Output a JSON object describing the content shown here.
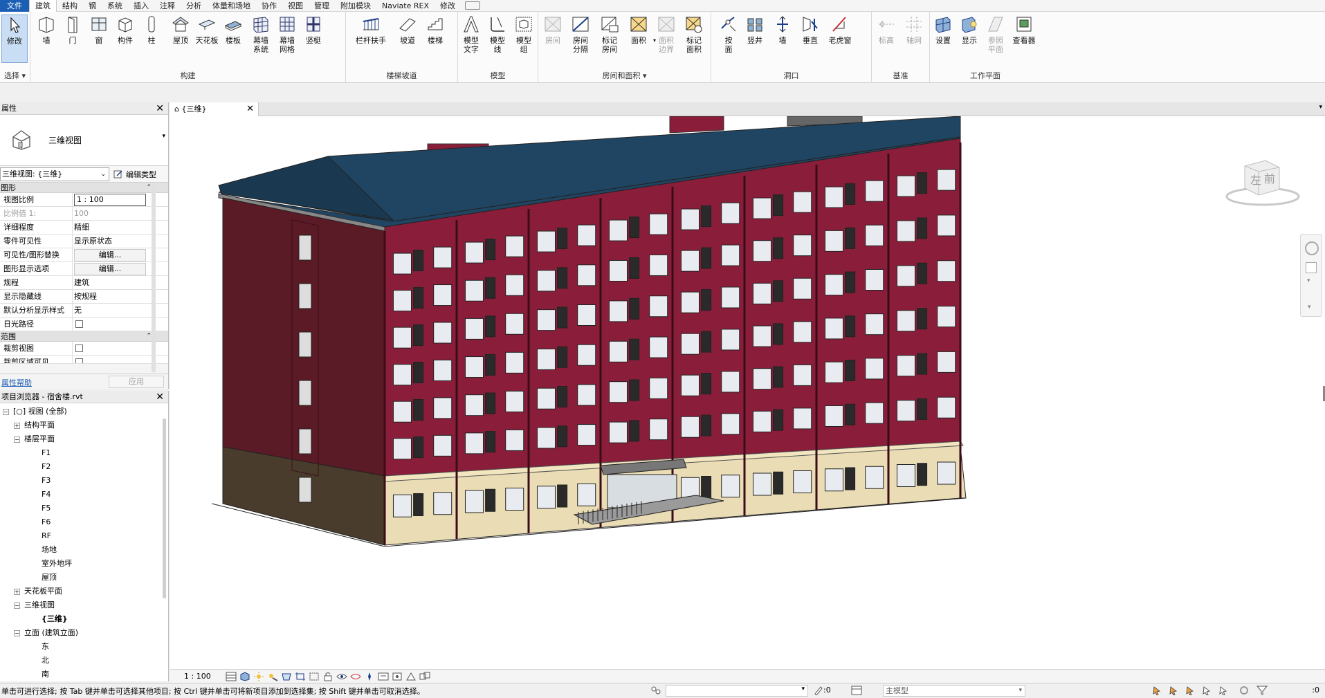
{
  "menu": {
    "items": [
      "文件",
      "建筑",
      "结构",
      "钢",
      "系统",
      "插入",
      "注释",
      "分析",
      "体量和场地",
      "协作",
      "视图",
      "管理",
      "附加模块",
      "Naviate REX",
      "修改"
    ]
  },
  "ribbon": {
    "select": {
      "tool": "修改",
      "label": "选择"
    },
    "build": {
      "label": "构建",
      "tools": [
        "墙",
        "门",
        "窗",
        "构件",
        "柱",
        "屋顶",
        "天花板",
        "楼板",
        "幕墙\n系统",
        "幕墙\n网格",
        "竖梃"
      ]
    },
    "circulation": {
      "label": "楼梯坡道",
      "tools": [
        "栏杆扶手",
        "坡道",
        "楼梯"
      ]
    },
    "model": {
      "label": "模型",
      "tools": [
        "模型\n文字",
        "模型\n线",
        "模型\n组"
      ]
    },
    "room_area": {
      "label": "房间和面积",
      "tools": [
        "房间",
        "房间\n分隔",
        "标记\n房间",
        "面积",
        "面积\n边界",
        "标记\n面积"
      ]
    },
    "opening": {
      "label": "洞口",
      "tools": [
        "按\n面",
        "竖井",
        "墙",
        "垂直",
        "老虎窗"
      ]
    },
    "datum": {
      "label": "基准",
      "tools": [
        "标高",
        "轴网"
      ]
    },
    "workplane": {
      "label": "工作平面",
      "tools": [
        "设置",
        "显示",
        "参照\n平面",
        "查看器"
      ]
    }
  },
  "properties": {
    "title": "属性",
    "type_name": "三维视图",
    "view_selector": "三维视图: {三维}",
    "edit_type": "编辑类型",
    "graphics_header": "图形",
    "rows": [
      {
        "name": "视图比例",
        "value": "1 : 100"
      },
      {
        "name": "比例值 1:",
        "value": "100"
      },
      {
        "name": "详细程度",
        "value": "精细"
      },
      {
        "name": "零件可见性",
        "value": "显示原状态"
      },
      {
        "name": "可见性/图形替换",
        "value": "编辑..."
      },
      {
        "name": "图形显示选项",
        "value": "编辑..."
      },
      {
        "name": "规程",
        "value": "建筑"
      },
      {
        "name": "显示隐藏线",
        "value": "按规程"
      },
      {
        "name": "默认分析显示样式",
        "value": "无"
      },
      {
        "name": "日光路径",
        "value": ""
      }
    ],
    "extents_header": "范围",
    "extents_rows": [
      {
        "name": "裁剪视图",
        "value": ""
      },
      {
        "name": "裁剪区域可见",
        "value": ""
      }
    ],
    "help": "属性帮助",
    "apply": "应用"
  },
  "browser": {
    "title": "项目浏览器 - 宿舍楼.rvt",
    "tree": [
      {
        "label": "视图 (全部)",
        "level": 0,
        "toggle": "−"
      },
      {
        "label": "结构平面",
        "level": 1,
        "toggle": "+"
      },
      {
        "label": "楼层平面",
        "level": 1,
        "toggle": "−"
      },
      {
        "label": "F1",
        "level": 2
      },
      {
        "label": "F2",
        "level": 2
      },
      {
        "label": "F3",
        "level": 2
      },
      {
        "label": "F4",
        "level": 2
      },
      {
        "label": "F5",
        "level": 2
      },
      {
        "label": "F6",
        "level": 2
      },
      {
        "label": "RF",
        "level": 2
      },
      {
        "label": "场地",
        "level": 2
      },
      {
        "label": "室外地坪",
        "level": 2
      },
      {
        "label": "屋顶",
        "level": 2
      },
      {
        "label": "天花板平面",
        "level": 1,
        "toggle": "+"
      },
      {
        "label": "三维视图",
        "level": 1,
        "toggle": "−"
      },
      {
        "label": "{三维}",
        "level": 2,
        "bold": true
      },
      {
        "label": "立面 (建筑立面)",
        "level": 1,
        "toggle": "−"
      },
      {
        "label": "东",
        "level": 2
      },
      {
        "label": "北",
        "level": 2
      },
      {
        "label": "南",
        "level": 2
      }
    ]
  },
  "viewport": {
    "tab": "{三维}",
    "viewcube": {
      "left": "左",
      "front": "前"
    },
    "scale": "1 : 100"
  },
  "status": {
    "text": "单击可进行选择; 按 Tab 键并单击可选择其他项目; 按 Ctrl 键并单击可将新项目添加到选择集; 按 Shift 键并单击可取消选择。",
    "ws_count": ":0",
    "model": "主模型",
    "filter_count": ":0"
  },
  "colors": {
    "wall": "#8a1e3a",
    "wall_side": "#5a1a26",
    "roof": "#1f4562",
    "base": "#eadcb4",
    "file_tab": "#1a5fb4"
  }
}
